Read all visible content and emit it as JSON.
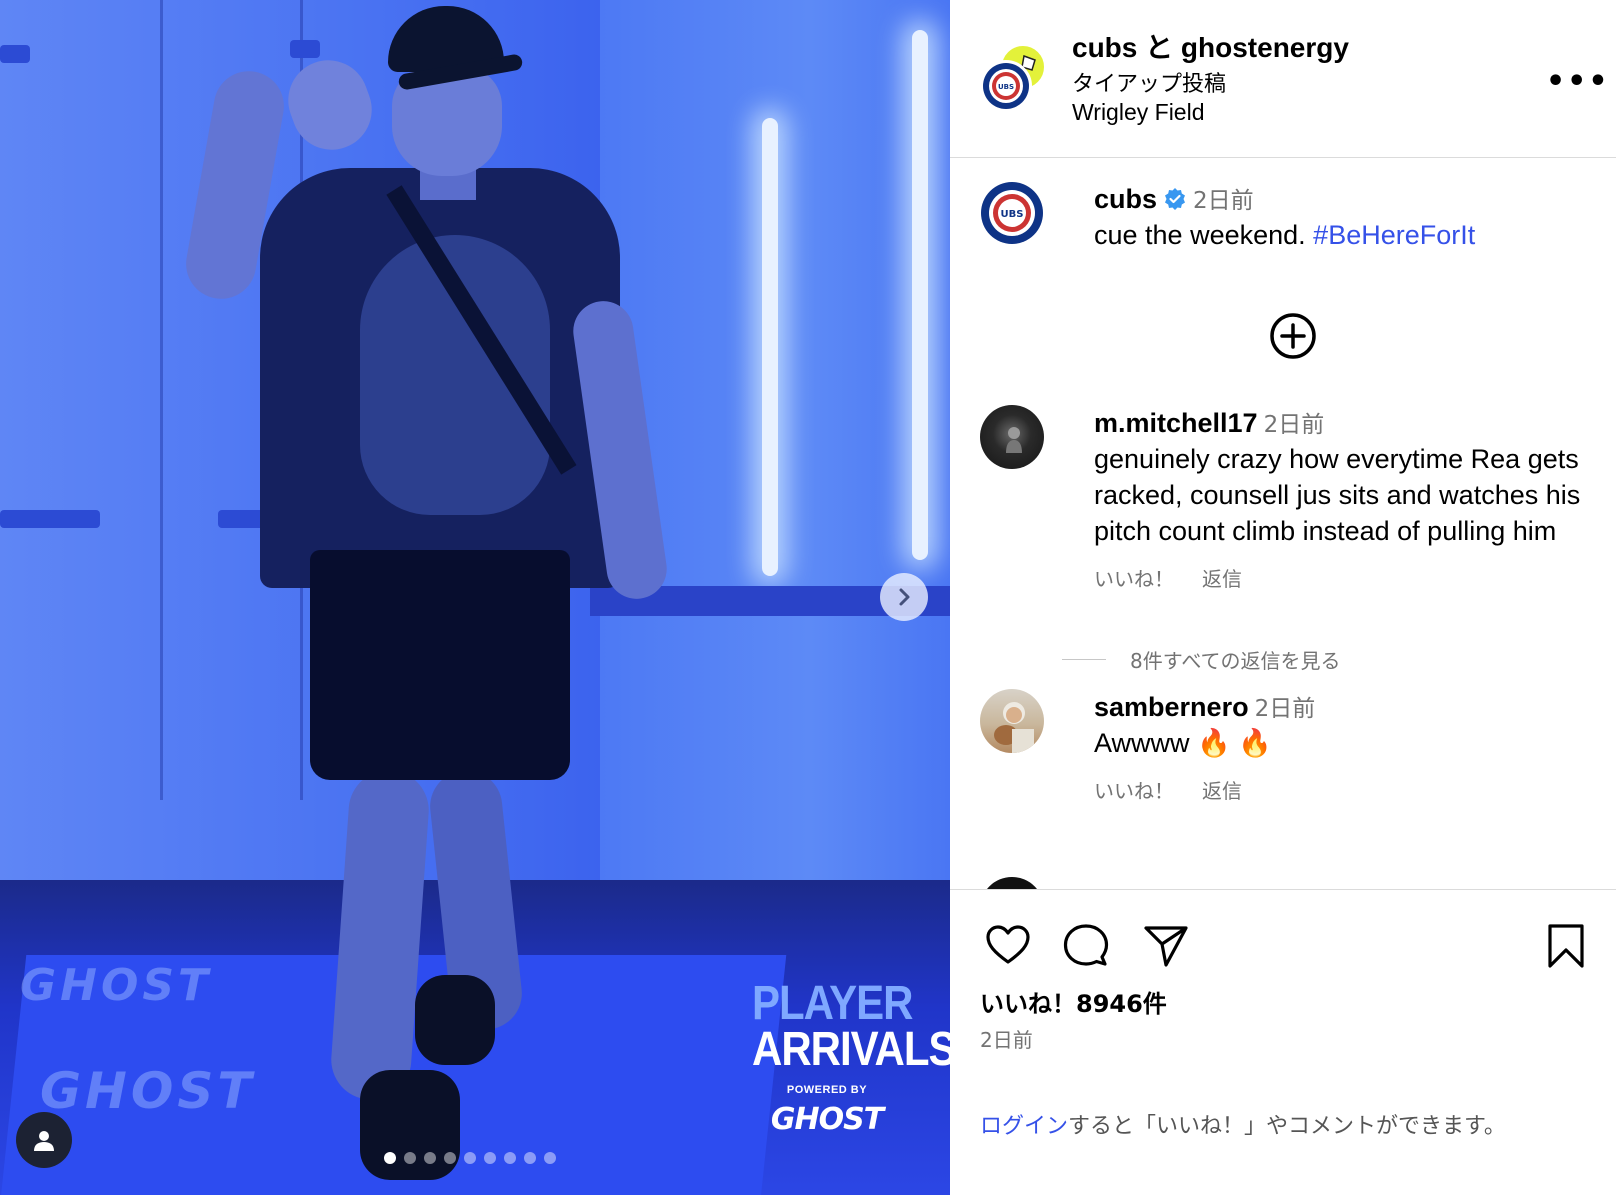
{
  "post": {
    "overlay": {
      "arrivals_line1": "PLAYER",
      "arrivals_line2": "ARRIVALS",
      "powered_by": "POWERED BY",
      "sponsor": "GHOST",
      "carpet_text": "GHOST"
    },
    "carousel": {
      "total": 9,
      "current": 1
    }
  },
  "header": {
    "title": "cubs と ghostenergy",
    "subtitle": "タイアップ投稿",
    "location": "Wrigley Field",
    "more": "•••"
  },
  "caption": {
    "user": "cubs",
    "time": "2日前",
    "text": "cue the weekend.",
    "hashtag": "#BeHereForIt"
  },
  "comments": [
    {
      "user": "m.mitchell17",
      "time": "2日前",
      "text": "genuinely crazy how everytime Rea gets racked, counsell jus sits and watches his pitch count climb instead of pulling him",
      "like": "いいね！",
      "reply": "返信",
      "view_replies": "8件すべての返信を見る"
    },
    {
      "user": "sambernero",
      "time": "2日前",
      "text": "Awwww 🔥 🔥",
      "like": "いいね！",
      "reply": "返信"
    }
  ],
  "footer": {
    "likes": "いいね！8946件",
    "posted": "2日前",
    "login_link": "ログイン",
    "login_rest": "すると「いいね！」やコメントができます。"
  },
  "colors": {
    "link": "#3551e8",
    "verified": "#3897f0",
    "cubs_blue": "#0e3386",
    "cubs_red": "#cc3433"
  }
}
